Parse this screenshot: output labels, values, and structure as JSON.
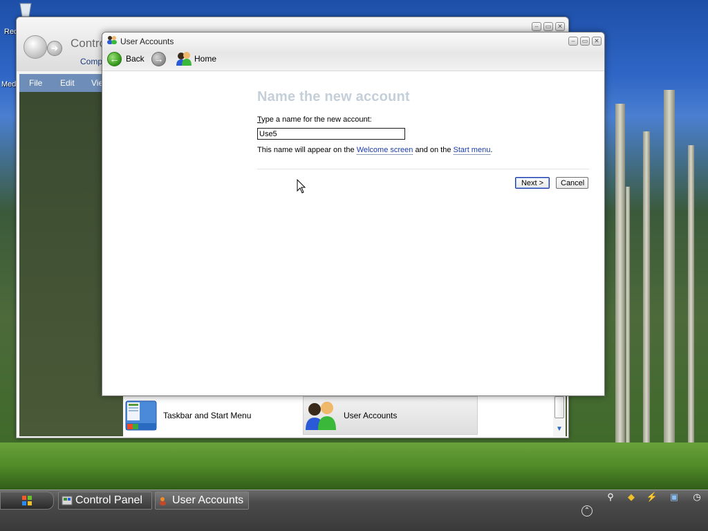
{
  "desktop": {
    "icon_label_1": "Rec",
    "icon_label_2": "Med"
  },
  "control_panel": {
    "title": "Contro",
    "subtitle": "Comp",
    "menu": [
      "File",
      "Edit",
      "Vie"
    ],
    "tiles": [
      {
        "label": "Taskbar and Start Menu",
        "icon": "taskbar-icon"
      },
      {
        "label": "User Accounts",
        "icon": "user-accounts-icon"
      }
    ]
  },
  "user_accounts": {
    "title": "User Accounts",
    "nav": {
      "back_label": "Back",
      "home_label": "Home"
    },
    "heading": "Name the new account",
    "prompt_prefix": "T",
    "prompt_rest": "ype a name for the new account:",
    "name_value": "Use5",
    "hint_prefix": "This name will appear on the ",
    "hint_link1": "Welcome screen",
    "hint_middle": " and on the ",
    "hint_link2": "Start menu",
    "hint_suffix": ".",
    "next_label": "Next >",
    "cancel_label": "Cancel"
  },
  "taskbar": {
    "items": [
      {
        "label": "Control Panel",
        "active": false
      },
      {
        "label": "User Accounts",
        "active": true
      }
    ]
  },
  "colors": {
    "link": "#1a3aa8",
    "heading": "#c4cfd9",
    "taskbar": "#3a3a3a"
  }
}
